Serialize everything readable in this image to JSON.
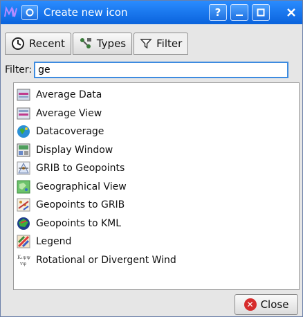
{
  "window": {
    "title": "Create new icon",
    "help_label": "?",
    "minimize_label": "_",
    "maximize_label": "□",
    "close_label": "✕",
    "menu_label": "▣"
  },
  "tabs": [
    {
      "label": "Recent",
      "icon": "clock-icon"
    },
    {
      "label": "Types",
      "icon": "types-icon"
    },
    {
      "label": "Filter",
      "icon": "filter-icon"
    }
  ],
  "filter": {
    "label": "Filter:",
    "value": "ge"
  },
  "items": [
    {
      "label": "Average Data",
      "icon": "average-data-icon"
    },
    {
      "label": "Average View",
      "icon": "average-view-icon"
    },
    {
      "label": "Datacoverage",
      "icon": "datacoverage-icon"
    },
    {
      "label": "Display Window",
      "icon": "display-window-icon"
    },
    {
      "label": "GRIB to Geopoints",
      "icon": "grib-to-geopoints-icon"
    },
    {
      "label": "Geographical View",
      "icon": "geographical-view-icon"
    },
    {
      "label": "Geopoints to GRIB",
      "icon": "geopoints-to-grib-icon"
    },
    {
      "label": "Geopoints to KML",
      "icon": "geopoints-to-kml-icon"
    },
    {
      "label": "Legend",
      "icon": "legend-icon"
    },
    {
      "label": "Rotational or Divergent Wind",
      "icon": "rotational-wind-icon"
    }
  ],
  "footer": {
    "close_label": "Close"
  }
}
